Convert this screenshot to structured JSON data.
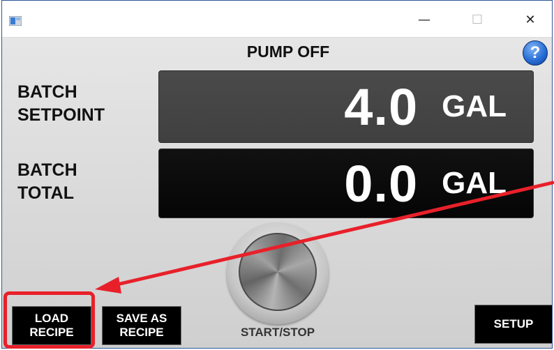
{
  "window": {
    "minimize_glyph": "—",
    "maximize_glyph": "☐",
    "close_glyph": "✕",
    "frame_color": "#2b5797"
  },
  "status": {
    "text": "PUMP OFF"
  },
  "help": {
    "glyph": "?",
    "icon": "help-icon",
    "color": "#2a6fd6"
  },
  "batch_setpoint": {
    "label_line1": "BATCH",
    "label_line2": "SETPOINT",
    "value": "4.0",
    "unit": "GAL"
  },
  "batch_total": {
    "label_line1": "BATCH",
    "label_line2": "TOTAL",
    "value": "0.0",
    "unit": "GAL"
  },
  "controls": {
    "start_stop_label": "START/STOP",
    "load_recipe_line1": "LOAD",
    "load_recipe_line2": "RECIPE",
    "save_recipe_line1": "SAVE AS",
    "save_recipe_line2": "RECIPE",
    "setup_label": "SETUP"
  },
  "annotation": {
    "color": "#e8202a",
    "target": "load-recipe-button"
  }
}
